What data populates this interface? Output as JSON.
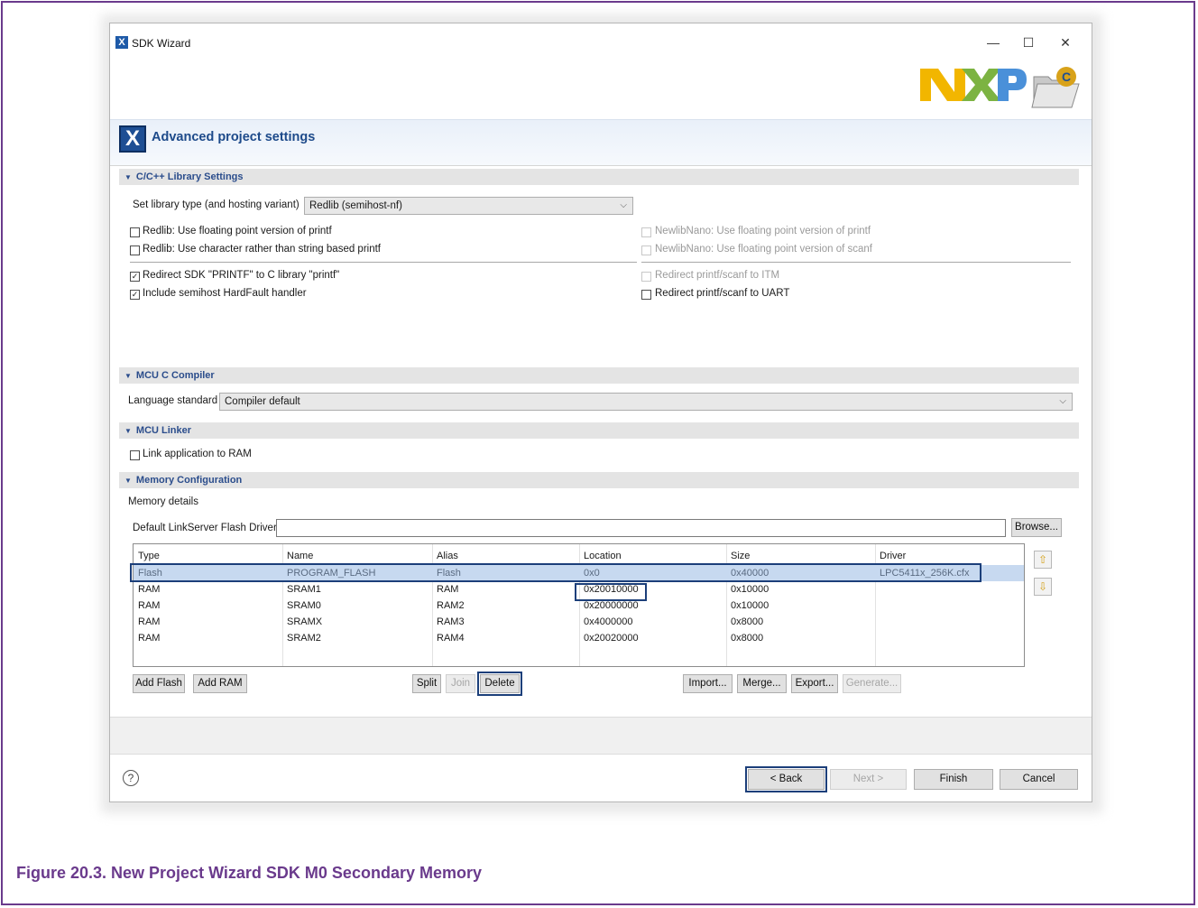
{
  "window": {
    "title": "SDK Wizard",
    "minimize": "—",
    "maximize": "☐",
    "close": "✕"
  },
  "header": {
    "title": "Advanced project settings"
  },
  "sections": {
    "library": "C/C++ Library Settings",
    "compiler": "MCU C Compiler",
    "linker": "MCU Linker",
    "memory": "Memory Configuration"
  },
  "library": {
    "type_label": "Set library type (and hosting variant)",
    "type_value": "Redlib (semihost-nf)",
    "options": [
      {
        "label": "Redlib: Use floating point version of printf",
        "checked": false,
        "enabled": true
      },
      {
        "label": "Redlib: Use character rather than string based printf",
        "checked": false,
        "enabled": true
      },
      {
        "label": "NewlibNano: Use floating point version of printf",
        "checked": false,
        "enabled": false
      },
      {
        "label": "NewlibNano: Use floating point version of scanf",
        "checked": false,
        "enabled": false
      },
      {
        "label": "Redirect SDK \"PRINTF\" to C library \"printf\"",
        "checked": true,
        "enabled": true
      },
      {
        "label": "Include semihost HardFault handler",
        "checked": true,
        "enabled": true
      },
      {
        "label": "Redirect printf/scanf to ITM",
        "checked": false,
        "enabled": false
      },
      {
        "label": "Redirect printf/scanf to UART",
        "checked": false,
        "enabled": true
      }
    ]
  },
  "compiler": {
    "language_label": "Language standard",
    "language_value": "Compiler default"
  },
  "linker": {
    "link_ram_label": "Link application to RAM",
    "link_ram_checked": false
  },
  "memory": {
    "details_label": "Memory details",
    "flash_driver_label": "Default LinkServer Flash Driver",
    "flash_driver_value": "",
    "browse": "Browse...",
    "columns": [
      "Type",
      "Name",
      "Alias",
      "Location",
      "Size",
      "Driver"
    ],
    "rows": [
      [
        "Flash",
        "PROGRAM_FLASH",
        "Flash",
        "0x0",
        "0x40000",
        "LPC5411x_256K.cfx"
      ],
      [
        "RAM",
        "SRAM1",
        "RAM",
        "0x20010000",
        "0x10000",
        ""
      ],
      [
        "RAM",
        "SRAM0",
        "RAM2",
        "0x20000000",
        "0x10000",
        ""
      ],
      [
        "RAM",
        "SRAMX",
        "RAM3",
        "0x4000000",
        "0x8000",
        ""
      ],
      [
        "RAM",
        "SRAM2",
        "RAM4",
        "0x20020000",
        "0x8000",
        ""
      ]
    ],
    "buttons": {
      "add_flash": "Add Flash",
      "add_ram": "Add RAM",
      "split": "Split",
      "join": "Join",
      "delete": "Delete",
      "import": "Import...",
      "merge": "Merge...",
      "export": "Export...",
      "generate": "Generate..."
    }
  },
  "footer": {
    "back": "< Back",
    "next": "Next >",
    "finish": "Finish",
    "cancel": "Cancel",
    "help": "?"
  },
  "logo": {
    "brand": "NXP"
  },
  "caption": "Figure 20.3. New Project Wizard SDK M0 Secondary Memory"
}
